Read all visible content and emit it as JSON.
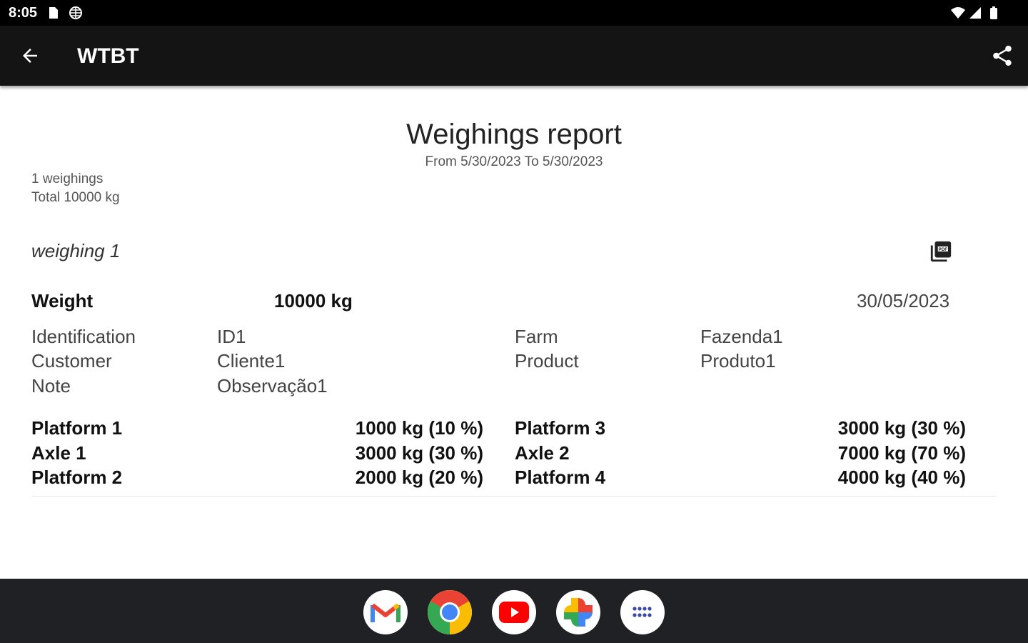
{
  "status_bar": {
    "time": "8:05",
    "left_icons": [
      "sd-card-icon",
      "vpn-globe-icon"
    ],
    "right_icons": [
      "wifi-icon",
      "cell-signal-icon",
      "battery-icon"
    ]
  },
  "app_bar": {
    "title": "WTBT",
    "back_icon": "arrow-back-icon",
    "share_icon": "share-icon",
    "background": "#141414"
  },
  "report": {
    "title": "Weighings report",
    "range": "From 5/30/2023 To 5/30/2023",
    "count": "1 weighings",
    "total": "Total 10000 kg"
  },
  "weighing": {
    "title": "weighing 1",
    "pdf_icon": "picture-as-pdf-icon",
    "weight_label": "Weight",
    "weight_value": "10000 kg",
    "date": "30/05/2023",
    "fields": {
      "identification_label": "Identification",
      "identification_value": "ID1",
      "customer_label": "Customer",
      "customer_value": "Cliente1",
      "note_label": "Note",
      "note_value": "Observação1",
      "farm_label": "Farm",
      "farm_value": "Fazenda1",
      "product_label": "Product",
      "product_value": "Produto1"
    },
    "left_breakdown": [
      {
        "label": "Platform 1",
        "value": "1000 kg (10 %)"
      },
      {
        "label": "Axle 1",
        "value": "3000 kg (30 %)"
      },
      {
        "label": "Platform 2",
        "value": "2000 kg (20 %)"
      }
    ],
    "right_breakdown": [
      {
        "label": "Platform 3",
        "value": "3000 kg (30 %)"
      },
      {
        "label": "Axle 2",
        "value": "7000 kg (70 %)"
      },
      {
        "label": "Platform 4",
        "value": "4000 kg (40 %)"
      }
    ]
  },
  "dock": {
    "apps": [
      "gmail-icon",
      "chrome-icon",
      "youtube-icon",
      "google-photos-icon",
      "app-drawer-icon"
    ]
  }
}
